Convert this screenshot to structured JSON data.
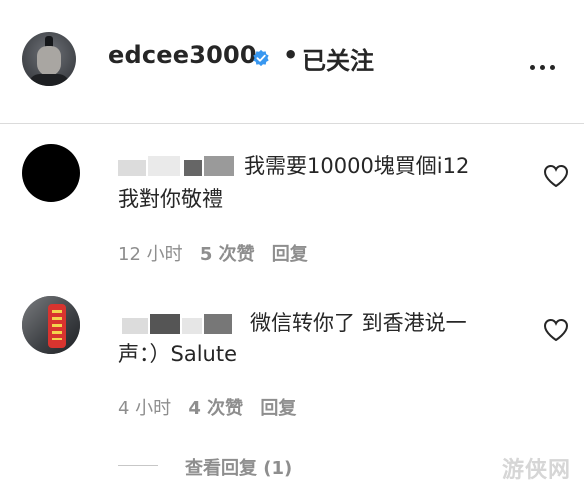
{
  "post": {
    "username": "edcee3000",
    "separator": "•",
    "follow_status": "已关注",
    "verified_color": "#3897f0"
  },
  "comments": [
    {
      "text_line1": "我需要10000塊買個i12",
      "text_line2": "我對你敬禮",
      "time": "12 小时",
      "likes": "5 次赞",
      "reply": "回复"
    },
    {
      "text_line1": "微信转你了 到香港说一",
      "text_line2": "声：）Salute",
      "time": "4 小时",
      "likes": "4 次赞",
      "reply": "回复"
    }
  ],
  "view_replies": "查看回复 (1)",
  "watermark": "游侠网",
  "icons": {
    "post_avatar": "profile-avatar-icon",
    "verified": "verified-badge-icon",
    "more": "more-options-icon",
    "heart": "heart-outline-icon"
  }
}
